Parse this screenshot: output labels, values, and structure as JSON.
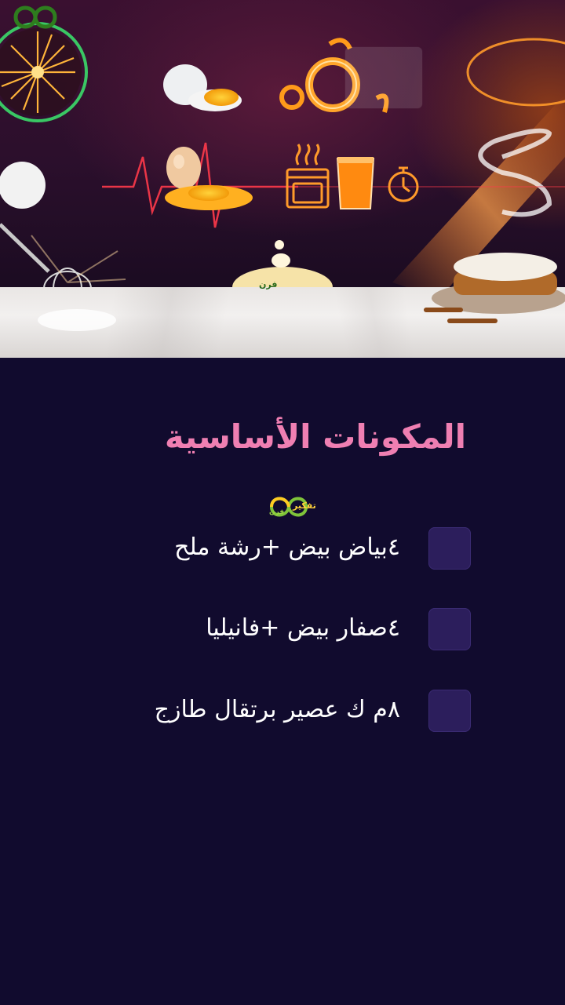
{
  "hero": {
    "logo_text": "فرن",
    "icons": [
      "firework-icon",
      "egg-icon",
      "cracked-egg-icon",
      "orange-peel-icon",
      "oven-icon",
      "juice-glass-icon",
      "timer-icon",
      "whisk-icon",
      "flour-icon",
      "cake-icon"
    ]
  },
  "content": {
    "title": "المكونات الأساسية",
    "brand": {
      "main": "تفكير",
      "sub": "فرن"
    },
    "items": [
      {
        "label": "٤بياض بيض  +رشة ملح",
        "checked": false
      },
      {
        "label": "٤صفار بيض  +فانيليا",
        "checked": false
      },
      {
        "label": "٨م ك عصير برتقال طازج",
        "checked": false
      }
    ]
  },
  "colors": {
    "background": "#110b2e",
    "title": "#ef7fb2",
    "checkbox": "#2c1e5c",
    "item_text": "#ffffff"
  }
}
